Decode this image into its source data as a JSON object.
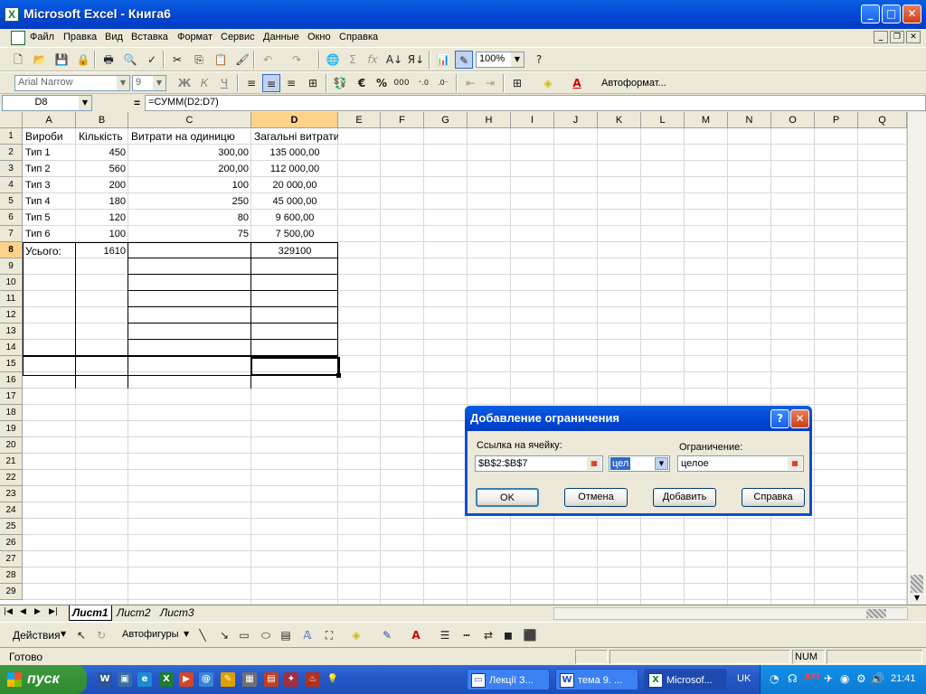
{
  "window": {
    "title": "Microsoft Excel - Книга6"
  },
  "menu": [
    "Файл",
    "Правка",
    "Вид",
    "Вставка",
    "Формат",
    "Сервис",
    "Данные",
    "Окно",
    "Справка"
  ],
  "toolbar": {
    "zoom": "100%",
    "font": "Arial Narrow",
    "size": "9",
    "autoformat": "Автоформат..."
  },
  "formula": {
    "namebox": "D8",
    "eq": "=",
    "text": "=СУММ(D2:D7)"
  },
  "columns": [
    "A",
    "B",
    "C",
    "D",
    "E",
    "F",
    "G",
    "H",
    "I",
    "J",
    "K",
    "L",
    "M",
    "N",
    "O",
    "P",
    "Q"
  ],
  "rows": [
    "1",
    "2",
    "3",
    "4",
    "5",
    "6",
    "7",
    "8",
    "9",
    "10",
    "11",
    "12",
    "13",
    "14",
    "15",
    "16",
    "17",
    "18",
    "19",
    "20",
    "21",
    "22",
    "23",
    "24",
    "25",
    "26",
    "27",
    "28",
    "29"
  ],
  "table": {
    "headers": [
      "Вироби",
      "Кількість",
      "Витрати на одиницю",
      "Загальні витрати"
    ],
    "body": [
      [
        "Тип 1",
        "450",
        "300,00",
        "135 000,00"
      ],
      [
        "Тип 2",
        "560",
        "200,00",
        "112 000,00"
      ],
      [
        "Тип 3",
        "200",
        "100",
        "20 000,00"
      ],
      [
        "Тип 4",
        "180",
        "250",
        "45 000,00"
      ],
      [
        "Тип 5",
        "120",
        "80",
        "9 600,00"
      ],
      [
        "Тип 6",
        "100",
        "75",
        "7 500,00"
      ]
    ],
    "total": [
      "Усього:",
      "1610",
      "",
      "329100"
    ]
  },
  "sheets": [
    "Лист1",
    "Лист2",
    "Лист3"
  ],
  "drawbar": {
    "actions": "Действия",
    "autoshapes": "Автофигуры"
  },
  "status": {
    "ready": "Готово",
    "num": "NUM"
  },
  "taskbar": {
    "start": "пуск",
    "buttons": [
      "Лекції З...",
      "тема 9. ...",
      "Microsof..."
    ],
    "lang": "UK",
    "clock": "21:41"
  },
  "dialog": {
    "title": "Добавление ограничения",
    "cell_ref_label": "Ссылка на ячейку:",
    "cell_ref_value": "$B$2:$B$7",
    "operator": "цел",
    "constraint_label": "Ограничение:",
    "constraint_value": "целое",
    "ok": "OK",
    "cancel": "Отмена",
    "add": "Добавить",
    "help": "Справка"
  }
}
